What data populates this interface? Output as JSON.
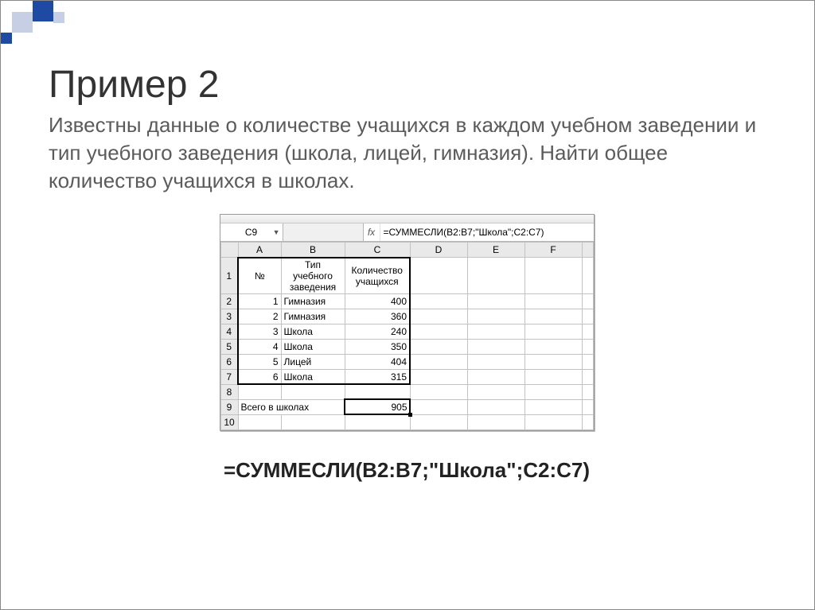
{
  "slide": {
    "title": "Пример 2",
    "intro": "Известны данные о количестве учащихся в каждом учебном заведении и тип учебного заведения (школа, лицей, гимназия). Найти общее количество учащихся в школах.",
    "formula_display": "=СУММЕСЛИ(B2:B7;\"Школа\";C2:C7)"
  },
  "spreadsheet": {
    "name_box": "C9",
    "fx_label": "fx",
    "formula_bar": "=СУММЕСЛИ(B2:B7;\"Школа\";C2:C7)",
    "columns": [
      "A",
      "B",
      "C",
      "D",
      "E",
      "F"
    ],
    "row_headers": [
      "1",
      "2",
      "3",
      "4",
      "5",
      "6",
      "7",
      "8",
      "9",
      "10"
    ],
    "headers": {
      "a": "№",
      "b": "Тип учебного заведения",
      "c": "Количество учащихся"
    },
    "rows": [
      {
        "n": "1",
        "type": "Гимназия",
        "cnt": "400"
      },
      {
        "n": "2",
        "type": "Гимназия",
        "cnt": "360"
      },
      {
        "n": "3",
        "type": "Школа",
        "cnt": "240"
      },
      {
        "n": "4",
        "type": "Школа",
        "cnt": "350"
      },
      {
        "n": "5",
        "type": "Лицей",
        "cnt": "404"
      },
      {
        "n": "6",
        "type": "Школа",
        "cnt": "315"
      }
    ],
    "total_label": "Всего в школах",
    "total_value": "905"
  }
}
